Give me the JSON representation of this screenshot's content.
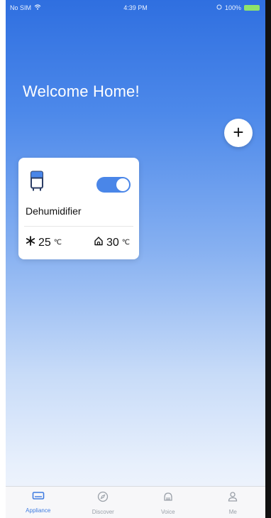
{
  "status_bar": {
    "carrier": "No SIM",
    "time": "4:39 PM",
    "battery": "100%"
  },
  "header": {
    "welcome": "Welcome Home!",
    "add_button_label": "+"
  },
  "device_card": {
    "name": "Dehumidifier",
    "power_on": true,
    "set_temp": "25",
    "set_unit": "℃",
    "indoor_temp": "30",
    "indoor_unit": "℃"
  },
  "tabs": [
    {
      "label": "Appliance",
      "icon": "appliance-icon",
      "active": true
    },
    {
      "label": "Discover",
      "icon": "compass-icon",
      "active": false
    },
    {
      "label": "Voice",
      "icon": "speaker-icon",
      "active": false
    },
    {
      "label": "Me",
      "icon": "user-icon",
      "active": false
    }
  ],
  "colors": {
    "accent": "#3f7be0",
    "toggle": "#4a86e8"
  }
}
